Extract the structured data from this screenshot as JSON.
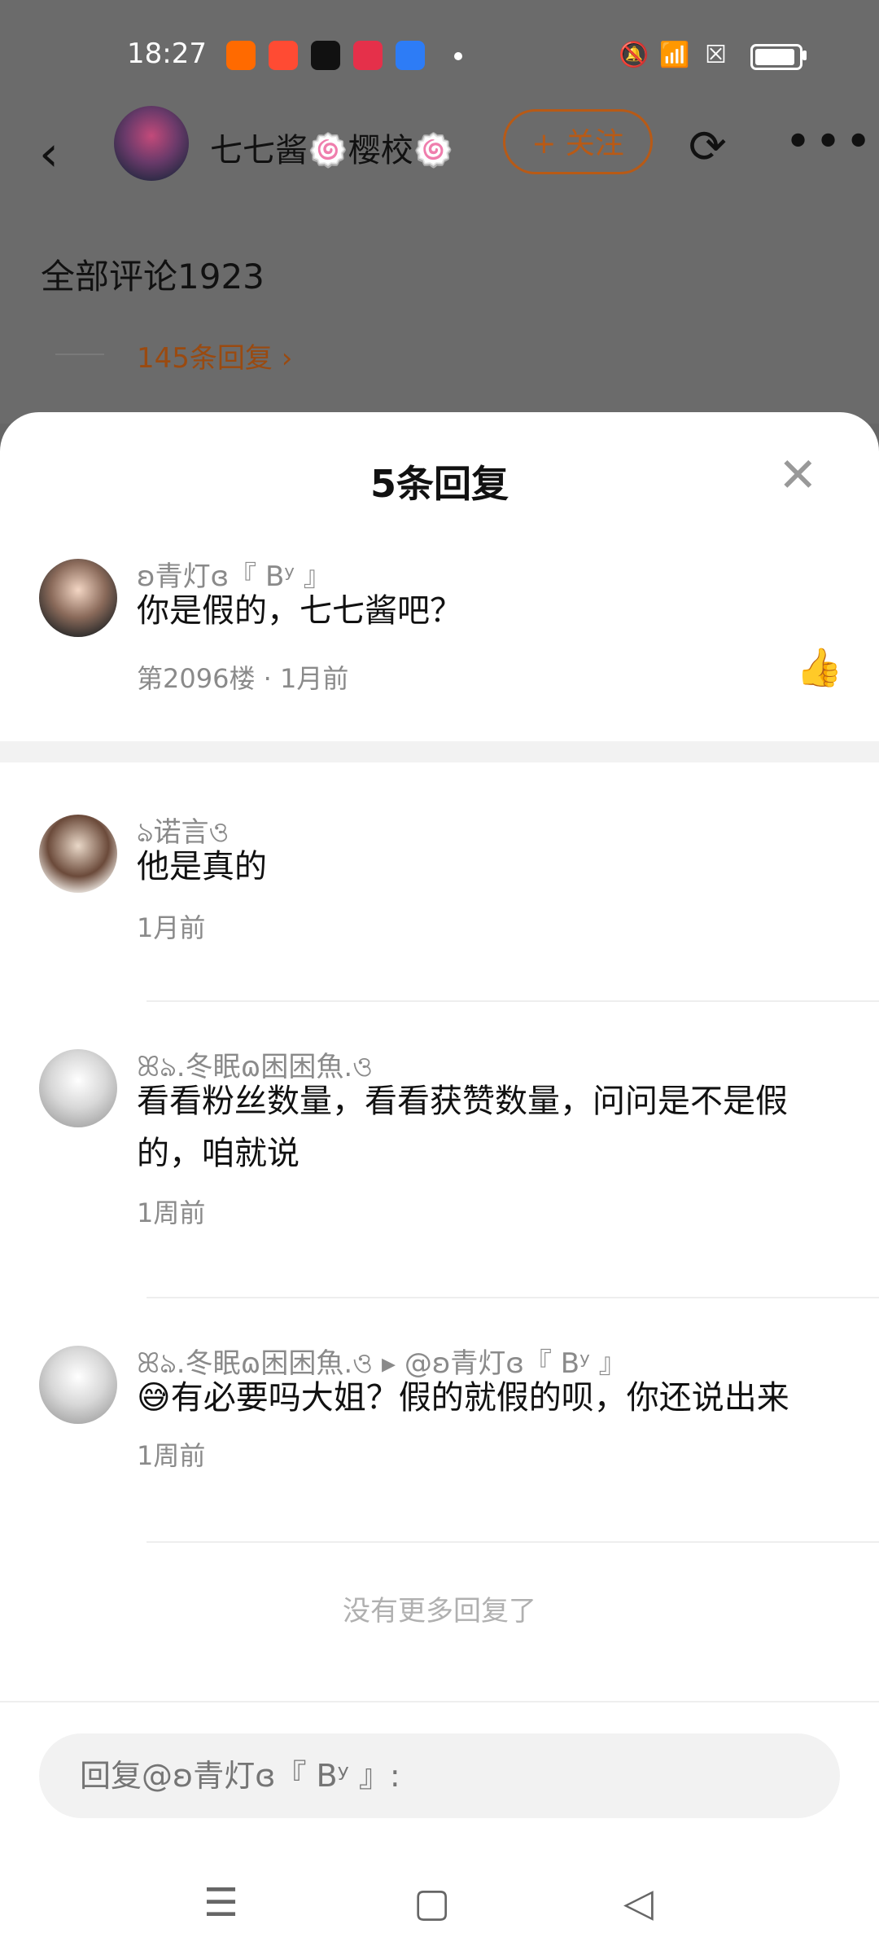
{
  "status_bar": {
    "time": "18:27",
    "app_icons": [
      {
        "name": "taobao-app-icon",
        "color": "#ff6a00",
        "glyph": "淘"
      },
      {
        "name": "meituan-app-icon",
        "color": "#ff4b33",
        "glyph": "邑"
      },
      {
        "name": "tiktok-app-icon",
        "color": "#111111",
        "glyph": "♪"
      },
      {
        "name": "video-app-icon",
        "color": "#e5304a",
        "glyph": "▶"
      },
      {
        "name": "infinity-app-icon",
        "color": "#2d7cf6",
        "glyph": "∞"
      }
    ]
  },
  "header": {
    "back_glyph": "‹",
    "username": "七七酱🍥樱校🍥",
    "follow_label": "+ 关注",
    "share_glyph": "⟳",
    "more_glyph": "•••"
  },
  "background": {
    "all_comments": "全部评论1923",
    "more_replies": "145条回复 ›"
  },
  "sheet": {
    "title": "5条回复",
    "close_glyph": "✕",
    "main_comment": {
      "name": "ʚ青灯ɞ『 Bʸ 』",
      "text": "你是假的，七七酱吧？",
      "meta": "第2096楼 · 1月前",
      "like_glyph": "👍"
    },
    "replies": [
      {
        "name": "ঌ诺言ও",
        "text": "他是真的",
        "meta": "1月前"
      },
      {
        "name": "ꕤঌ.冬眠ɷ困困魚.ও",
        "text": "看看粉丝数量，看看获赞数量，问问是不是假的，咱就说",
        "meta": "1周前"
      },
      {
        "name": "ꕤঌ.冬眠ɷ困困魚.ও ▸ @ʚ青灯ɞ『 Bʸ 』",
        "text": "😅有必要吗大姐？假的就假的呗，你还说出来",
        "meta": "1周前"
      }
    ],
    "no_more": "没有更多回复了",
    "reply_placeholder": "回复@ʚ青灯ɞ『 Bʸ 』:"
  },
  "navbar": {
    "menu_glyph": "☰",
    "home_glyph": "▢",
    "back_glyph": "◁"
  }
}
